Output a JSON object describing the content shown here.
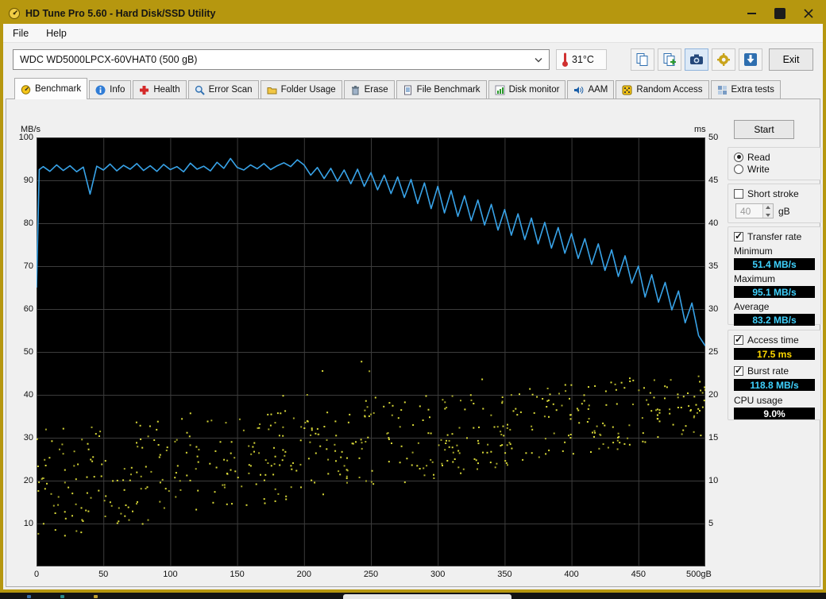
{
  "window": {
    "title": "HD Tune Pro 5.60 - Hard Disk/SSD Utility"
  },
  "menu": {
    "items": [
      {
        "label": "File"
      },
      {
        "label": "Help"
      }
    ]
  },
  "toolbar": {
    "drive_selector": "WDC WD5000LPCX-60VHAT0 (500 gB)",
    "temperature": "31°C",
    "buttons": [
      {
        "name": "copy-to-clipboard"
      },
      {
        "name": "copy-text-info"
      },
      {
        "name": "screenshot"
      },
      {
        "name": "options"
      },
      {
        "name": "save"
      }
    ],
    "exit_label": "Exit"
  },
  "tabs": {
    "active": "Benchmark",
    "items": [
      {
        "label": "Benchmark",
        "icon": "benchmark-icon"
      },
      {
        "label": "Info",
        "icon": "info-icon"
      },
      {
        "label": "Health",
        "icon": "health-icon"
      },
      {
        "label": "Error Scan",
        "icon": "error-scan-icon"
      },
      {
        "label": "Folder Usage",
        "icon": "folder-usage-icon"
      },
      {
        "label": "Erase",
        "icon": "erase-icon"
      },
      {
        "label": "File Benchmark",
        "icon": "file-benchmark-icon"
      },
      {
        "label": "Disk monitor",
        "icon": "disk-monitor-icon"
      },
      {
        "label": "AAM",
        "icon": "aam-icon"
      },
      {
        "label": "Random Access",
        "icon": "random-access-icon"
      },
      {
        "label": "Extra tests",
        "icon": "extra-tests-icon"
      }
    ]
  },
  "panel": {
    "start_label": "Start",
    "mode": {
      "read_label": "Read",
      "write_label": "Write",
      "selected": "Read"
    },
    "short_stroke": {
      "label": "Short stroke",
      "checked": false,
      "value": "40",
      "unit": "gB"
    },
    "transfer_rate": {
      "label": "Transfer rate",
      "checked": true,
      "minimum_label": "Minimum",
      "minimum_value": "51.4 MB/s",
      "maximum_label": "Maximum",
      "maximum_value": "95.1 MB/s",
      "average_label": "Average",
      "average_value": "83.2 MB/s"
    },
    "access_time": {
      "label": "Access time",
      "checked": true,
      "value": "17.5 ms"
    },
    "burst_rate": {
      "label": "Burst rate",
      "checked": true,
      "value": "118.8 MB/s"
    },
    "cpu_usage": {
      "label": "CPU usage",
      "value": "9.0%"
    }
  },
  "colors": {
    "accent_gold": "#b6970f",
    "value_cyan": "#3fd2ff",
    "value_yellow": "#ffd800",
    "value_white": "#ffffff"
  },
  "chart_data": {
    "type": "line",
    "title": "HD Tune read benchmark",
    "grid": true,
    "grid_color": "#3c3c3c",
    "x_axis": {
      "min": 0,
      "max": 500,
      "ticks": [
        0,
        50,
        100,
        150,
        200,
        250,
        300,
        350,
        400,
        450
      ],
      "end_label": "500gB"
    },
    "left_axis": {
      "label": "MB/s",
      "min": 0,
      "max": 100,
      "ticks": [
        100,
        90,
        80,
        70,
        60,
        50,
        40,
        30,
        20,
        10
      ]
    },
    "right_axis": {
      "label": "ms",
      "min": 0,
      "max": 50,
      "ticks": [
        50,
        45,
        40,
        35,
        30,
        25,
        20,
        15,
        10,
        5
      ]
    },
    "series": [
      {
        "name": "transfer-rate",
        "style": "line",
        "axis": "left",
        "unit": "MB/s",
        "color": "#38a3e8",
        "points": [
          [
            0,
            65
          ],
          [
            2,
            92.5
          ],
          [
            5,
            93.2
          ],
          [
            10,
            92.1
          ],
          [
            15,
            93.6
          ],
          [
            20,
            92.3
          ],
          [
            25,
            93.4
          ],
          [
            30,
            92.0
          ],
          [
            35,
            93.1
          ],
          [
            40,
            86.8
          ],
          [
            45,
            93.3
          ],
          [
            50,
            92.4
          ],
          [
            55,
            93.8
          ],
          [
            60,
            92.2
          ],
          [
            65,
            93.5
          ],
          [
            70,
            92.6
          ],
          [
            75,
            93.9
          ],
          [
            80,
            92.3
          ],
          [
            85,
            93.4
          ],
          [
            90,
            92.1
          ],
          [
            95,
            93.7
          ],
          [
            100,
            92.5
          ],
          [
            105,
            93.2
          ],
          [
            110,
            92.0
          ],
          [
            115,
            94.0
          ],
          [
            120,
            92.6
          ],
          [
            125,
            93.3
          ],
          [
            130,
            92.2
          ],
          [
            135,
            94.2
          ],
          [
            140,
            92.8
          ],
          [
            145,
            95.1
          ],
          [
            150,
            93.0
          ],
          [
            155,
            92.4
          ],
          [
            160,
            93.6
          ],
          [
            165,
            92.7
          ],
          [
            170,
            93.9
          ],
          [
            175,
            92.5
          ],
          [
            180,
            93.4
          ],
          [
            185,
            94.1
          ],
          [
            190,
            93.2
          ],
          [
            195,
            94.8
          ],
          [
            200,
            93.6
          ],
          [
            205,
            91.2
          ],
          [
            210,
            93.0
          ],
          [
            215,
            90.4
          ],
          [
            220,
            92.8
          ],
          [
            225,
            89.8
          ],
          [
            230,
            92.4
          ],
          [
            235,
            89.2
          ],
          [
            240,
            92.6
          ],
          [
            245,
            88.6
          ],
          [
            250,
            91.8
          ],
          [
            255,
            87.8
          ],
          [
            260,
            91.2
          ],
          [
            265,
            86.9
          ],
          [
            270,
            90.8
          ],
          [
            275,
            86.0
          ],
          [
            280,
            90.2
          ],
          [
            285,
            84.6
          ],
          [
            290,
            89.4
          ],
          [
            295,
            83.4
          ],
          [
            300,
            88.6
          ],
          [
            305,
            82.4
          ],
          [
            310,
            87.6
          ],
          [
            315,
            81.6
          ],
          [
            320,
            86.4
          ],
          [
            325,
            80.6
          ],
          [
            330,
            85.4
          ],
          [
            335,
            79.6
          ],
          [
            340,
            84.4
          ],
          [
            345,
            78.4
          ],
          [
            350,
            83.2
          ],
          [
            355,
            77.2
          ],
          [
            360,
            82.2
          ],
          [
            365,
            76.2
          ],
          [
            370,
            81.2
          ],
          [
            375,
            75.2
          ],
          [
            380,
            80.2
          ],
          [
            385,
            74.2
          ],
          [
            390,
            79.0
          ],
          [
            395,
            73.0
          ],
          [
            400,
            77.6
          ],
          [
            405,
            71.8
          ],
          [
            410,
            76.4
          ],
          [
            415,
            70.4
          ],
          [
            420,
            75.2
          ],
          [
            425,
            69.0
          ],
          [
            430,
            73.8
          ],
          [
            435,
            67.6
          ],
          [
            440,
            72.4
          ],
          [
            445,
            66.0
          ],
          [
            450,
            70.0
          ],
          [
            455,
            62.8
          ],
          [
            460,
            68.0
          ],
          [
            465,
            61.6
          ],
          [
            470,
            66.2
          ],
          [
            475,
            59.8
          ],
          [
            480,
            64.2
          ],
          [
            485,
            56.8
          ],
          [
            490,
            61.4
          ],
          [
            495,
            53.8
          ],
          [
            500,
            51.4
          ]
        ]
      },
      {
        "name": "access-time",
        "style": "scatter",
        "axis": "right",
        "unit": "ms",
        "color": "#d8d838",
        "color_dim": "#a8a82a",
        "scatter": {
          "count": 560,
          "seed": 1337,
          "base_start": 9.5,
          "slope_per_gb": 0.019,
          "spread_start": 13,
          "spread_end": 7.5,
          "outlier_chance": 0.07,
          "outlier_max": 6,
          "min": 2,
          "max": 27
        }
      }
    ]
  }
}
